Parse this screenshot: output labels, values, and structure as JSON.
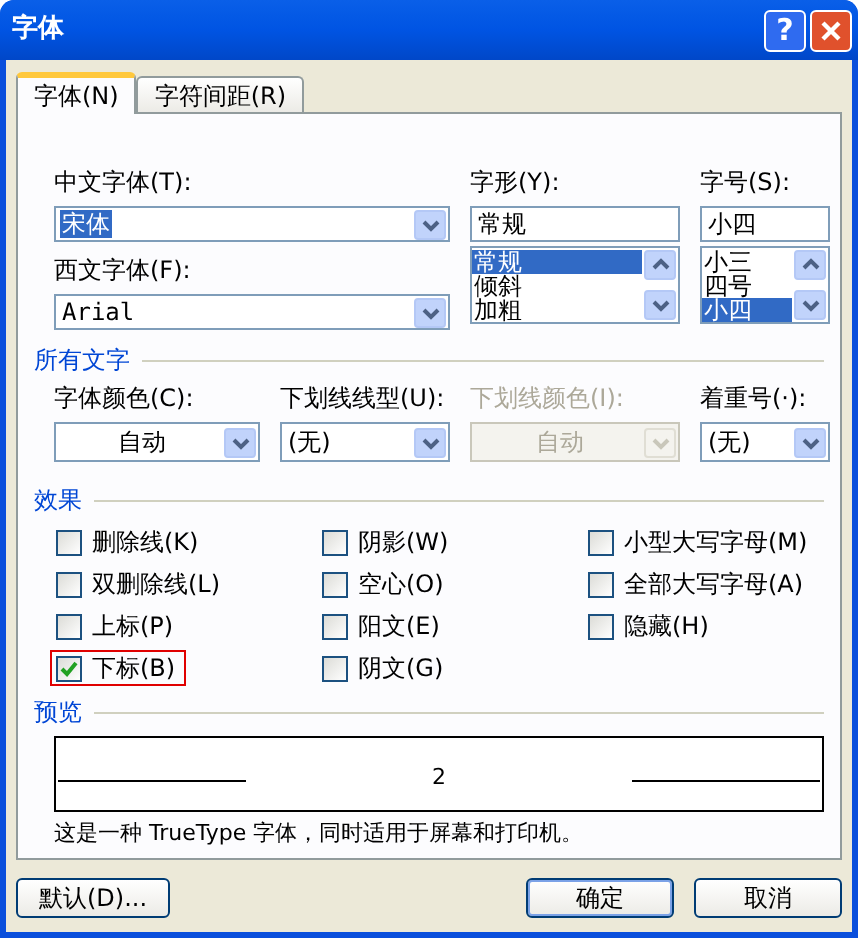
{
  "window": {
    "title": "字体",
    "help_button": "?"
  },
  "tabs": [
    {
      "label": "字体(N)",
      "selected": true
    },
    {
      "label": "字符间距(R)",
      "selected": false
    }
  ],
  "chinese_font": {
    "label": "中文字体(T):",
    "value": "宋体",
    "text_selected": true
  },
  "western_font": {
    "label": "西文字体(F):",
    "value": "Arial",
    "text_selected": false
  },
  "font_style": {
    "label": "字形(Y):",
    "value": "常规",
    "options": [
      {
        "label": "常规",
        "selected": true
      },
      {
        "label": "倾斜",
        "selected": false
      },
      {
        "label": "加粗",
        "selected": false
      }
    ]
  },
  "font_size": {
    "label": "字号(S):",
    "value": "小四",
    "options": [
      {
        "label": "小三",
        "selected": false
      },
      {
        "label": "四号",
        "selected": false
      },
      {
        "label": "小四",
        "selected": true
      }
    ]
  },
  "all_text": {
    "heading": "所有文字",
    "fields": [
      {
        "label": "字体颜色(C):",
        "value": "自动",
        "kind": "color",
        "disabled": false
      },
      {
        "label": "下划线线型(U):",
        "value": "(无)",
        "kind": "list",
        "disabled": false
      },
      {
        "label": "下划线颜色(I):",
        "value": "自动",
        "kind": "color",
        "disabled": true
      },
      {
        "label": "着重号(·):",
        "value": "(无)",
        "kind": "list",
        "disabled": false
      }
    ]
  },
  "effects": {
    "heading": "效果",
    "columns": [
      [
        {
          "label": "删除线(K)",
          "checked": false,
          "highlighted": false
        },
        {
          "label": "双删除线(L)",
          "checked": false,
          "highlighted": false
        },
        {
          "label": "上标(P)",
          "checked": false,
          "highlighted": false
        },
        {
          "label": "下标(B)",
          "checked": true,
          "highlighted": true
        }
      ],
      [
        {
          "label": "阴影(W)",
          "checked": false,
          "highlighted": false
        },
        {
          "label": "空心(O)",
          "checked": false,
          "highlighted": false
        },
        {
          "label": "阳文(E)",
          "checked": false,
          "highlighted": false
        },
        {
          "label": "阴文(G)",
          "checked": false,
          "highlighted": false
        }
      ],
      [
        {
          "label": "小型大写字母(M)",
          "checked": false,
          "highlighted": false
        },
        {
          "label": "全部大写字母(A)",
          "checked": false,
          "highlighted": false
        },
        {
          "label": "隐藏(H)",
          "checked": false,
          "highlighted": false
        }
      ]
    ]
  },
  "preview": {
    "heading": "预览",
    "sample": "2",
    "note": "这是一种 TrueType 字体，同时适用于屏幕和打印机。"
  },
  "buttons": [
    {
      "label": "默认(D)...",
      "default": false
    },
    {
      "label": "确定",
      "default": true
    },
    {
      "label": "取消",
      "default": false
    }
  ]
}
